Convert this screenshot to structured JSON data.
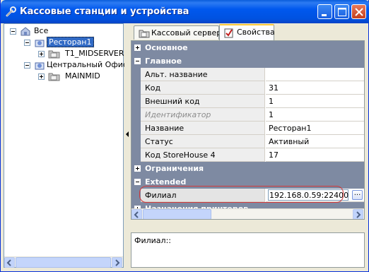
{
  "window": {
    "title": "Кассовые станции и устройства",
    "icon": "wrench-icon",
    "controls": [
      "minimize",
      "maximize",
      "close"
    ]
  },
  "tree": {
    "items": [
      {
        "label": "Все",
        "icon": "root-store-icon",
        "level": 0,
        "expanded": true
      },
      {
        "label": "Ресторан1",
        "icon": "restaurant-icon",
        "level": 1,
        "expanded": true,
        "selected": true
      },
      {
        "label": "T1_MIDSERVER",
        "icon": "folder-server-icon",
        "level": 2,
        "expanded": false
      },
      {
        "label": "Центральный Офис",
        "icon": "office-icon",
        "level": 1,
        "expanded": true
      },
      {
        "label": "MAINMID",
        "icon": "folder-server-icon",
        "level": 2,
        "expanded": false
      }
    ]
  },
  "tabs": [
    {
      "label": "Кассовый сервер",
      "icon": "folder-icon",
      "active": false
    },
    {
      "label": "Свойства",
      "icon": "properties-icon",
      "active": true
    }
  ],
  "properties": {
    "categories": {
      "basic": "Основное",
      "main": "Главное",
      "limits": "Ограничения",
      "extended": "Extended",
      "printers": "Назначения принтеров"
    },
    "main_rows": [
      {
        "name": "Альт. название",
        "value": ""
      },
      {
        "name": "Код",
        "value": "31"
      },
      {
        "name": "Внешний код",
        "value": "1"
      },
      {
        "name": "Идентификатор",
        "value": "1",
        "disabled": true
      },
      {
        "name": "Название",
        "value": "Ресторан1"
      },
      {
        "name": "Статус",
        "value": "Активный"
      },
      {
        "name": "Код StoreHouse 4",
        "value": "17"
      }
    ],
    "extended_rows": [
      {
        "name": "Филиал",
        "value": "192.168.0.59:22400",
        "editing": true,
        "button": "..."
      }
    ]
  },
  "description": {
    "text": "Филиал::"
  },
  "colors": {
    "titlebar": "#0058ee",
    "category_bg": "#7e8aa2",
    "selection": "#316ac5",
    "highlight_outline": "#d23a3a"
  }
}
